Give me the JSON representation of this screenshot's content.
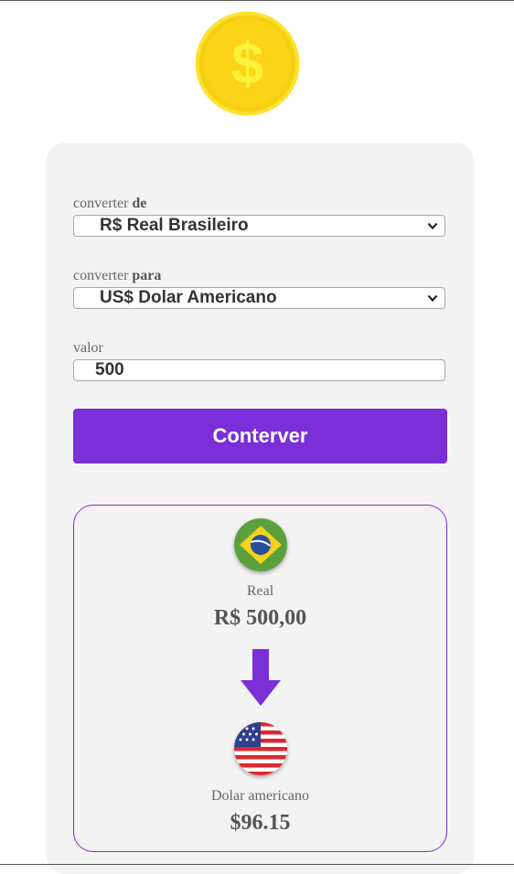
{
  "form": {
    "from_label": "converter",
    "from_label_bold": "de",
    "from_selected": "R$ Real Brasileiro",
    "to_label": "converter",
    "to_label_bold": "para",
    "to_selected": "US$ Dolar Americano",
    "value_label": "valor",
    "value_input": "500",
    "convert_button": "Conterver"
  },
  "result": {
    "from_currency_name": "Real",
    "from_currency_value": "R$ 500,00",
    "to_currency_name": "Dolar americano",
    "to_currency_value": "$96.15"
  },
  "icons": {
    "coin": "dollar-coin-icon",
    "from_flag": "brazil-flag-icon",
    "to_flag": "usa-flag-icon",
    "arrow": "arrow-down-icon"
  },
  "colors": {
    "accent": "#7a2fd8",
    "card_bg": "#f3f3f3",
    "coin": "#f5c518"
  }
}
